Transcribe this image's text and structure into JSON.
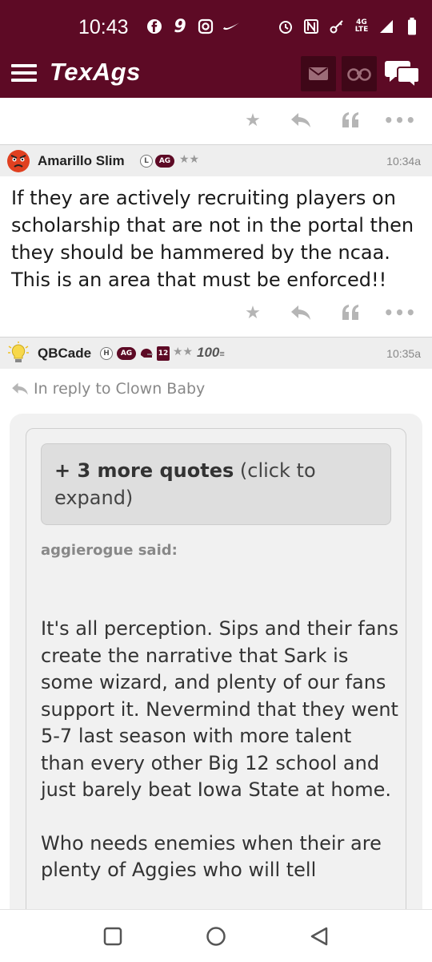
{
  "status_bar": {
    "time": "10:43",
    "network": [
      "4G",
      "LTE"
    ],
    "icons": [
      "facebook-icon",
      "nine-icon",
      "instagram-icon",
      "nike-icon",
      "alarm-icon",
      "nfc-icon",
      "key-icon",
      "signal-icon",
      "battery-icon"
    ]
  },
  "app_bar": {
    "logo": "TexAgs",
    "buttons": [
      "menu-icon",
      "mail-icon",
      "binoculars-icon",
      "chat-icon"
    ]
  },
  "colors": {
    "brand": "#5d0a25",
    "header_bg": "#eeeeee",
    "muted": "#888888"
  },
  "post_actions": [
    "star-icon",
    "reply-icon",
    "quote-icon",
    "more-icon"
  ],
  "posts": [
    {
      "author": "Amarillo Slim",
      "badges": [
        "L",
        "AG"
      ],
      "stars": "★★",
      "time": "10:34a",
      "body": "If they are actively recruiting players on scholarship that are not in the portal then they should be hammered by the ncaa. This is an area that must be enforced!!"
    },
    {
      "author": "QBCade",
      "badges": [
        "H",
        "AG",
        "12"
      ],
      "stars": "★★",
      "tag": "100",
      "time": "10:35a",
      "reply_to": "In reply to Clown Baby",
      "more_quotes_bold": "+ 3 more quotes",
      "more_quotes_rest": " (click to expand)",
      "quoted_author": "aggierogue said:",
      "quote_paragraphs": [
        "It's all perception. Sips and their fans create the narrative that Sark is some wizard, and plenty of our fans support it. Nevermind that they went 5-7 last season with more talent than every other Big 12 school and just barely beat Iowa State at home.",
        "Who needs enemies when their are plenty of Aggies who will tell"
      ]
    }
  ]
}
